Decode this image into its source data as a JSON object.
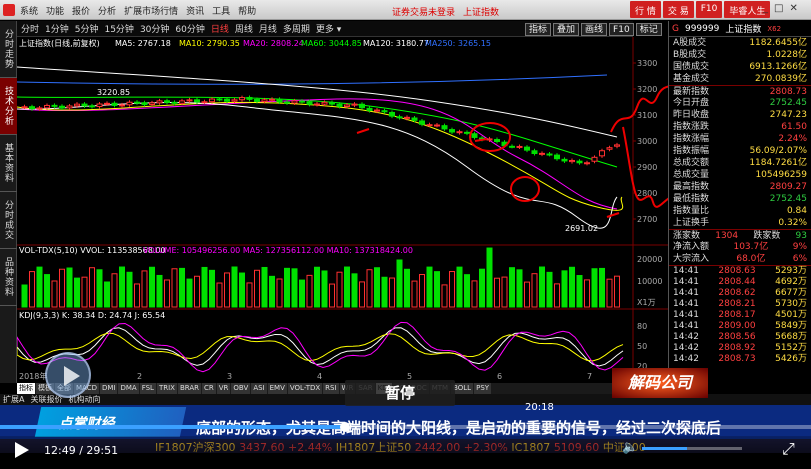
{
  "app": {
    "menu": [
      "系统",
      "功能",
      "报价",
      "分析",
      "扩展市场行情",
      "资讯",
      "工具",
      "帮助"
    ],
    "center_text": [
      "证券交易未登录",
      "上证指数"
    ],
    "right_buttons": [
      "行 情",
      "交 易",
      "F10",
      "毕睿人生"
    ],
    "window_controls": [
      "_",
      "□",
      "✕"
    ]
  },
  "left_tabs": [
    {
      "label": "分时走势",
      "active": false
    },
    {
      "label": "技术分析",
      "active": true
    },
    {
      "label": "基本资料",
      "active": false
    },
    {
      "label": "分时成交",
      "active": false
    },
    {
      "label": "品种资料",
      "active": false
    }
  ],
  "periods": [
    {
      "label": "分时",
      "on": false
    },
    {
      "label": "1分钟",
      "on": false
    },
    {
      "label": "5分钟",
      "on": false
    },
    {
      "label": "15分钟",
      "on": false
    },
    {
      "label": "30分钟",
      "on": false
    },
    {
      "label": "60分钟",
      "on": false
    },
    {
      "label": "日线",
      "on": true
    },
    {
      "label": "周线",
      "on": false
    },
    {
      "label": "月线",
      "on": false
    },
    {
      "label": "多周期",
      "on": false
    },
    {
      "label": "更多 ▾",
      "on": false
    }
  ],
  "toolbar": [
    "指标",
    "叠加",
    "画线",
    "F10",
    "标记"
  ],
  "chart": {
    "title": "上证指数(日线,前复权)",
    "ma": [
      {
        "label": "MA5: 2767.18",
        "color": "#ffffff"
      },
      {
        "label": "MA10: 2790.35",
        "color": "#ffff00"
      },
      {
        "label": "MA20: 2808.24",
        "color": "#ff00ff"
      },
      {
        "label": "MA60: 3044.85",
        "color": "#00ff00"
      },
      {
        "label": "MA120: 3180.77",
        "color": "#ffffff"
      },
      {
        "label": "MA250: 3265.15",
        "color": "#3070ff"
      }
    ],
    "price_axis": [
      "3300",
      "3200",
      "3100",
      "3000",
      "2900",
      "2800",
      "2700"
    ],
    "high_label": "3220.85",
    "low_label": "2691.02",
    "vol_title": "VOL-TDX(5,10) VVOL: 113538568.00",
    "vol_ma": "VOLUME: 105496256.00  MA5: 127356112.00  MA10: 137318424.00",
    "vol_axis": [
      "20000",
      "10000"
    ],
    "vol_unit": "X1万",
    "kdj_title": "KDJ(9,3,3) K: 38.34 D: 24.74 J: 65.54",
    "kdj_axis": [
      "80",
      "50",
      "20"
    ],
    "date_label": "2018年",
    "date_ticks": [
      "2",
      "3",
      "4",
      "5",
      "6",
      "7"
    ]
  },
  "bottom_tabs": [
    "指标",
    "模板",
    "全部",
    "MACD",
    "DMI",
    "DMA",
    "FSL",
    "TRIX",
    "BRAR",
    "CR",
    "VR",
    "OBV",
    "ASI",
    "EMV",
    "VOL-TDX",
    "RSI",
    "WR",
    "SAR",
    "KDJ",
    "CCI",
    "ROC",
    "MTM",
    "BOLL",
    "PSY"
  ],
  "bottom_tabs2": [
    "扩展A",
    "关联报价",
    "机构动向"
  ],
  "quote_panel": {
    "code": "999999",
    "name": "上证指数",
    "badge": "X62",
    "rows": [
      {
        "k": "A股成交",
        "v": "1182.6455亿",
        "c": "v"
      },
      {
        "k": "B股成交",
        "v": "1.0228亿",
        "c": "v"
      },
      {
        "k": "国债成交",
        "v": "6913.1266亿",
        "c": "v"
      },
      {
        "k": "基金成交",
        "v": "270.0839亿",
        "c": "v"
      },
      {
        "k": "最新指数",
        "v": "2808.73",
        "c": "red",
        "sep": true
      },
      {
        "k": "今日开盘",
        "v": "2752.45",
        "c": "grn"
      },
      {
        "k": "昨日收盘",
        "v": "2747.23",
        "c": "v"
      },
      {
        "k": "指数涨跌",
        "v": "61.50",
        "c": "red"
      },
      {
        "k": "指数涨幅",
        "v": "2.24%",
        "c": "red"
      },
      {
        "k": "指数振幅",
        "v": "56.09/2.07%",
        "c": "v"
      },
      {
        "k": "总成交额",
        "v": "1184.7261亿",
        "c": "v"
      },
      {
        "k": "总成交量",
        "v": "105496259",
        "c": "v"
      },
      {
        "k": "最高指数",
        "v": "2809.27",
        "c": "red"
      },
      {
        "k": "最低指数",
        "v": "2752.45",
        "c": "grn"
      },
      {
        "k": "指数量比",
        "v": "0.84",
        "c": "v"
      },
      {
        "k": "上证换手",
        "v": "0.32%",
        "c": "v"
      }
    ],
    "updown": {
      "up_label": "涨家数",
      "up": "1304",
      "down_label": "跌家数",
      "down": "93"
    },
    "flow": [
      {
        "k": "净流入额",
        "v": "103.7亿",
        "p": "9%"
      },
      {
        "k": "大宗流入",
        "v": "68.0亿",
        "p": "6%"
      }
    ],
    "ticks": [
      {
        "t": "14:41",
        "p": "2808.63",
        "v": "5293万"
      },
      {
        "t": "14:41",
        "p": "2808.44",
        "v": "4692万"
      },
      {
        "t": "14:41",
        "p": "2808.62",
        "v": "6677万"
      },
      {
        "t": "14:41",
        "p": "2808.21",
        "v": "5730万"
      },
      {
        "t": "14:41",
        "p": "2808.17",
        "v": "4501万"
      },
      {
        "t": "14:41",
        "p": "2809.00",
        "v": "5849万"
      },
      {
        "t": "14:42",
        "p": "2808.56",
        "v": "5668万"
      },
      {
        "t": "14:42",
        "p": "2808.92",
        "v": "5152万"
      },
      {
        "t": "14:42",
        "p": "2808.73",
        "v": "5426万"
      }
    ]
  },
  "video": {
    "pause_label": "暂停",
    "brand": "点掌财经",
    "subtitle": "底部的形态，尤其是高端时间的大阳线，是启动的重要的信号，经过二次探底后",
    "show_logo": "解码公司",
    "hover_time": "20:18",
    "time": "12:49 / 29:51",
    "ticker": [
      {
        "label": "IF1807沪深300",
        "val": "3437.60 +2.44%"
      },
      {
        "label": "IH1807上证50",
        "val": "2442.00 +2.30%"
      },
      {
        "label": "IC1807",
        "val": "5109.60"
      },
      {
        "label": "中证500",
        "val": ""
      }
    ]
  }
}
